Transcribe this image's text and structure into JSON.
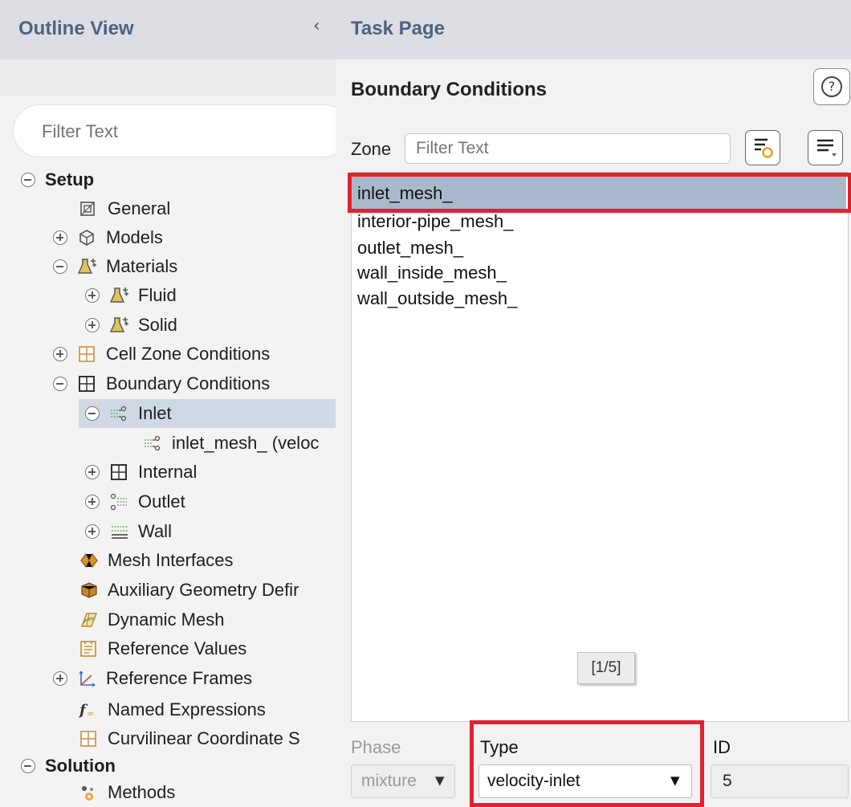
{
  "outline": {
    "title": "Outline View",
    "collapse_glyph": "‹",
    "filter_placeholder": "Filter Text",
    "items": [
      {
        "label": "Setup",
        "icon": "",
        "toggle": "minus"
      },
      {
        "label": "General",
        "icon": "general-icon"
      },
      {
        "label": "Models",
        "icon": "models-icon",
        "toggle": "plus"
      },
      {
        "label": "Materials",
        "icon": "materials-icon",
        "toggle": "minus"
      },
      {
        "label": "Fluid",
        "icon": "materials-icon",
        "toggle": "plus"
      },
      {
        "label": "Solid",
        "icon": "materials-icon",
        "toggle": "plus"
      },
      {
        "label": "Cell Zone Conditions",
        "icon": "cell-zone-icon",
        "toggle": "plus"
      },
      {
        "label": "Boundary Conditions",
        "icon": "boundary-icon",
        "toggle": "minus"
      },
      {
        "label": "Inlet",
        "icon": "inlet-icon",
        "toggle": "minus",
        "selected": true
      },
      {
        "label": "inlet_mesh_ (veloc",
        "icon": "inlet-icon"
      },
      {
        "label": "Internal",
        "icon": "boundary-icon",
        "toggle": "plus"
      },
      {
        "label": "Outlet",
        "icon": "outlet-icon",
        "toggle": "plus"
      },
      {
        "label": "Wall",
        "icon": "wall-icon",
        "toggle": "plus"
      },
      {
        "label": "Mesh Interfaces",
        "icon": "mesh-interfaces-icon"
      },
      {
        "label": "Auxiliary Geometry Defir",
        "icon": "auxiliary-geometry-icon"
      },
      {
        "label": "Dynamic Mesh",
        "icon": "dynamic-mesh-icon"
      },
      {
        "label": "Reference Values",
        "icon": "reference-values-icon"
      },
      {
        "label": "Reference Frames",
        "icon": "reference-frames-icon",
        "toggle": "plus"
      },
      {
        "label": "Named Expressions",
        "icon": "named-expressions-icon"
      },
      {
        "label": "Curvilinear Coordinate S",
        "icon": "cell-zone-icon"
      },
      {
        "label": "Solution",
        "icon": "",
        "toggle": "minus"
      },
      {
        "label": "Methods",
        "icon": "methods-icon"
      }
    ]
  },
  "task": {
    "title": "Task Page",
    "section_title": "Boundary Conditions",
    "help_glyph": "?",
    "zone_label": "Zone",
    "zone_filter_placeholder": "Filter Text",
    "zones": [
      "inlet_mesh_",
      "interior-pipe_mesh_",
      "outlet_mesh_",
      "wall_inside_mesh_",
      "wall_outside_mesh_"
    ],
    "selected_zone": "inlet_mesh_",
    "counter": "[1/5]",
    "phase_label": "Phase",
    "phase_value": "mixture",
    "type_label": "Type",
    "type_value": "velocity-inlet",
    "id_label": "ID",
    "id_value": "5",
    "dropdown_glyph": "▼"
  },
  "colors": {
    "highlight_red": "#e4202f",
    "header_bg": "#dcdee3",
    "header_text": "#4c6382",
    "selection": "#a9b9cd"
  }
}
